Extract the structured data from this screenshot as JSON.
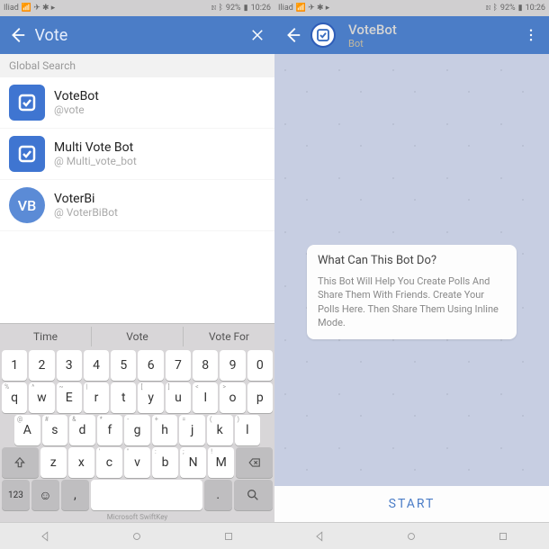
{
  "status": {
    "carrier": "Iliad",
    "battery": "92%",
    "time": "10:26"
  },
  "left": {
    "search_value": "Vote",
    "section": "Global Search",
    "results": [
      {
        "name": "VoteBot",
        "handle": "@vote",
        "avatar_type": "check",
        "avatar_bg": "#3f75d1"
      },
      {
        "name": "Multi Vote Bot",
        "handle": "@ Multi_vote_bot",
        "avatar_type": "check",
        "avatar_bg": "#3f75d1"
      },
      {
        "name": "VoterBi",
        "handle": "@ VoterBiBot",
        "avatar_type": "text",
        "avatar_text": "VB",
        "avatar_bg": "#5b8bd6"
      }
    ],
    "suggestions": [
      "Time",
      "Vote",
      "Vote For"
    ],
    "num_row": [
      "1",
      "2",
      "3",
      "4",
      "5",
      "6",
      "7",
      "8",
      "9",
      "0"
    ],
    "q_row": [
      "q",
      "w",
      "E",
      "r",
      "t",
      "y",
      "u",
      "I",
      "o",
      "p"
    ],
    "q_hints": [
      "%",
      "^",
      "~",
      "|",
      "",
      "[",
      "]",
      "<",
      ">",
      ""
    ],
    "a_row": [
      "A",
      "s",
      "d",
      "f",
      "g",
      "h",
      "j",
      "k",
      "l"
    ],
    "a_hints": [
      "@",
      "#",
      "&",
      "*",
      "-",
      "+",
      "=",
      "(",
      ")"
    ],
    "z_row": [
      "z",
      "x",
      "c",
      "v",
      "b",
      "N",
      "M"
    ],
    "z_hints": [
      "",
      "",
      "'",
      "\"",
      ":",
      ";",
      "!",
      "?"
    ],
    "branding": "Microsoft SwiftKey"
  },
  "right": {
    "title": "VoteBot",
    "subtitle": "Bot",
    "bubble_title": "What Can This Bot Do?",
    "bubble_body": "This Bot Will Help You Create Polls And Share Them With Friends. Create Your Polls Here. Then Share Them Using Inline Mode.",
    "start": "START"
  }
}
